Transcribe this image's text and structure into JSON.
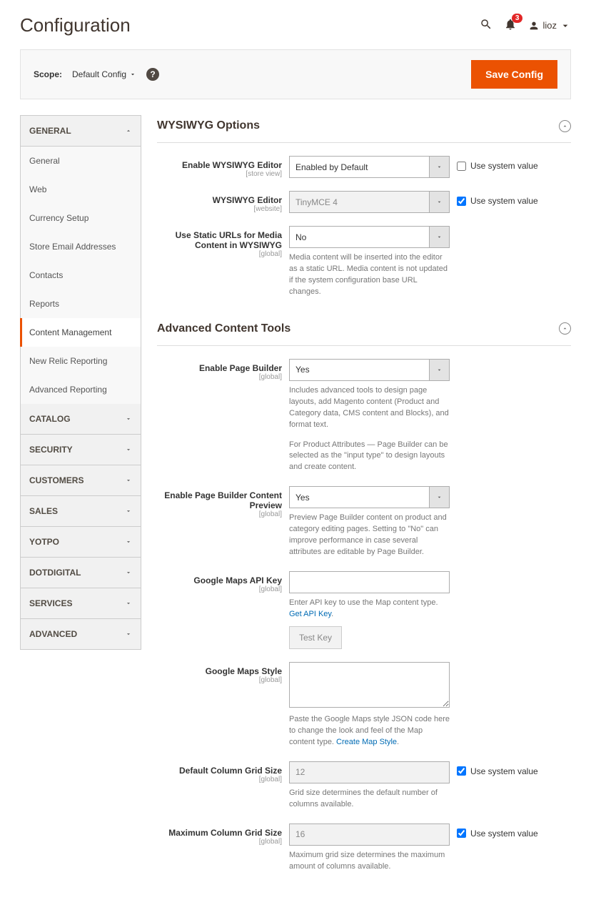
{
  "header": {
    "title": "Configuration",
    "badge": "3",
    "user": "lioz"
  },
  "scope": {
    "label": "Scope:",
    "value": "Default Config",
    "save": "Save Config"
  },
  "sys_label": "Use system value",
  "sidebar": {
    "groups": [
      {
        "label": "GENERAL",
        "expanded": true,
        "items": [
          "General",
          "Web",
          "Currency Setup",
          "Store Email Addresses",
          "Contacts",
          "Reports",
          "Content Management",
          "New Relic Reporting",
          "Advanced Reporting"
        ],
        "active": 6
      },
      {
        "label": "CATALOG",
        "expanded": false
      },
      {
        "label": "SECURITY",
        "expanded": false
      },
      {
        "label": "CUSTOMERS",
        "expanded": false
      },
      {
        "label": "SALES",
        "expanded": false
      },
      {
        "label": "YOTPO",
        "expanded": false
      },
      {
        "label": "DOTDIGITAL",
        "expanded": false
      },
      {
        "label": "SERVICES",
        "expanded": false
      },
      {
        "label": "ADVANCED",
        "expanded": false
      }
    ]
  },
  "sections": [
    {
      "title": "WYSIWYG Options",
      "fields": [
        {
          "id": "enable_wysiwyg",
          "label": "Enable WYSIWYG Editor",
          "scope": "[store view]",
          "type": "select",
          "value": "Enabled by Default",
          "sys": false,
          "sys_show": true
        },
        {
          "id": "wysiwyg_editor",
          "label": "WYSIWYG Editor",
          "scope": "[website]",
          "type": "select",
          "value": "TinyMCE 4",
          "sys": true,
          "sys_show": true,
          "disabled": true
        },
        {
          "id": "static_urls",
          "label": "Use Static URLs for Media Content in WYSIWYG",
          "scope": "[global]",
          "type": "select",
          "value": "No",
          "sys_show": false,
          "note": "Media content will be inserted into the editor as a static URL. Media content is not updated if the system configuration base URL changes."
        }
      ]
    },
    {
      "title": "Advanced Content Tools",
      "fields": [
        {
          "id": "enable_pb",
          "label": "Enable Page Builder",
          "scope": "[global]",
          "type": "select",
          "value": "Yes",
          "sys_show": false,
          "note": "Includes advanced tools to design page layouts, add Magento content (Product and Category data, CMS content and Blocks), and format text.",
          "note2": "For Product Attributes — Page Builder can be selected as the \"input type\" to design layouts and create content."
        },
        {
          "id": "pb_preview",
          "label": "Enable Page Builder Content Preview",
          "scope": "[global]",
          "type": "select",
          "value": "Yes",
          "sys_show": false,
          "note": "Preview Page Builder content on product and category editing pages. Setting to \"No\" can improve performance in case several attributes are editable by Page Builder."
        },
        {
          "id": "gmaps_key",
          "label": "Google Maps API Key",
          "scope": "[global]",
          "type": "input",
          "value": "",
          "sys_show": false,
          "note": "Enter API key to use the Map content type. ",
          "link": "Get API Key",
          "test": "Test Key"
        },
        {
          "id": "gmaps_style",
          "label": "Google Maps Style",
          "scope": "[global]",
          "type": "textarea",
          "value": "",
          "sys_show": false,
          "note": "Paste the Google Maps style JSON code here to change the look and feel of the Map content type. ",
          "link": "Create Map Style"
        },
        {
          "id": "def_grid",
          "label": "Default Column Grid Size",
          "scope": "[global]",
          "type": "input",
          "value": "12",
          "sys": true,
          "sys_show": true,
          "disabled": true,
          "note": "Grid size determines the default number of columns available."
        },
        {
          "id": "max_grid",
          "label": "Maximum Column Grid Size",
          "scope": "[global]",
          "type": "input",
          "value": "16",
          "sys": true,
          "sys_show": true,
          "disabled": true,
          "note": "Maximum grid size determines the maximum amount of columns available."
        }
      ]
    }
  ]
}
